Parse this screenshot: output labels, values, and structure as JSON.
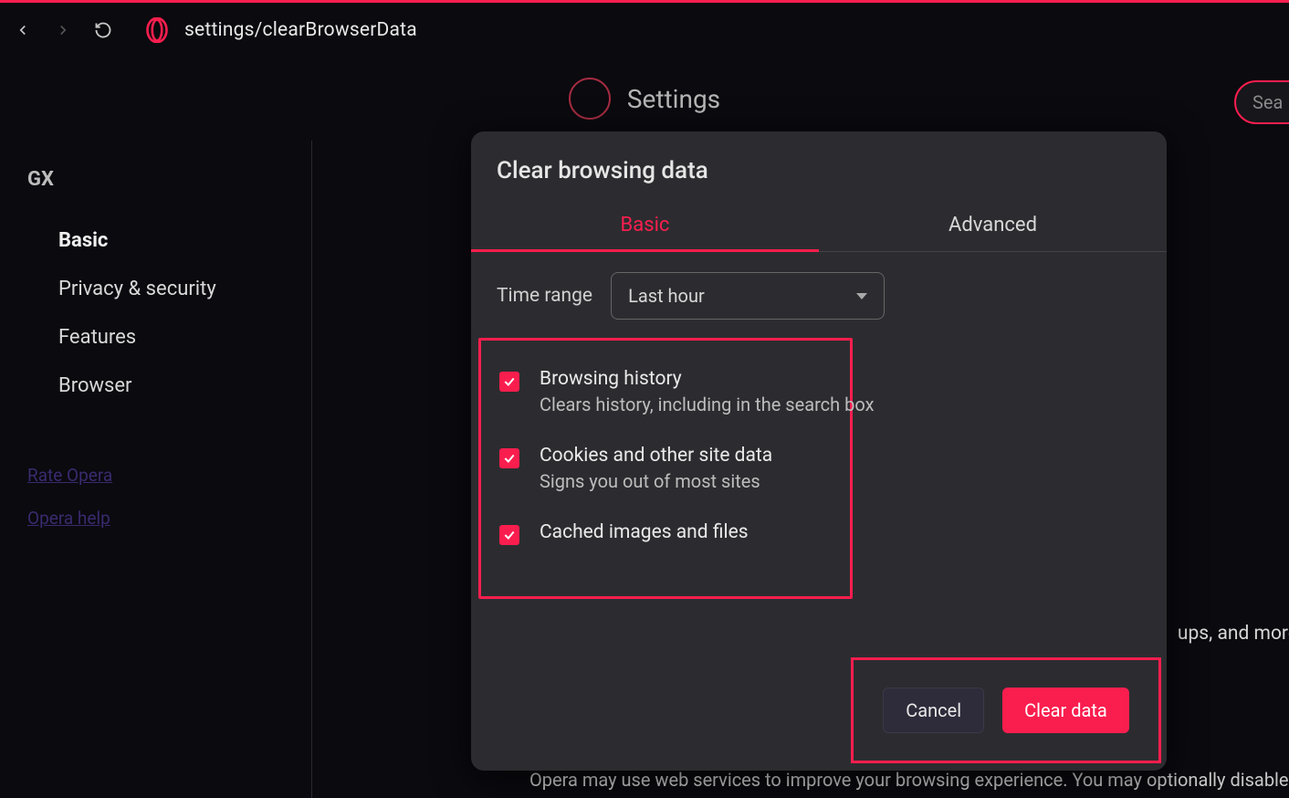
{
  "toolbar": {
    "url": "settings/clearBrowserData"
  },
  "settings": {
    "title": "Settings",
    "search_placeholder": "Sea"
  },
  "sidebar": {
    "group": "GX",
    "items": [
      {
        "label": "Basic",
        "active": true
      },
      {
        "label": "Privacy & security",
        "active": false
      },
      {
        "label": "Features",
        "active": false
      },
      {
        "label": "Browser",
        "active": false
      }
    ],
    "links": [
      {
        "label": "Rate Opera"
      },
      {
        "label": "Opera help"
      }
    ]
  },
  "background": {
    "line1": "ups, and more",
    "line2": "Opera may use web services to improve your browsing experience. You may optionally disable th"
  },
  "dialog": {
    "title": "Clear browsing data",
    "tabs": [
      {
        "label": "Basic",
        "active": true
      },
      {
        "label": "Advanced",
        "active": false
      }
    ],
    "time_range_label": "Time range",
    "time_range_value": "Last hour",
    "options": [
      {
        "title": "Browsing history",
        "desc": "Clears history, including in the search box",
        "checked": true
      },
      {
        "title": "Cookies and other site data",
        "desc": "Signs you out of most sites",
        "checked": true
      },
      {
        "title": "Cached images and files",
        "desc": "",
        "checked": true
      }
    ],
    "buttons": {
      "cancel": "Cancel",
      "confirm": "Clear data"
    }
  },
  "colors": {
    "accent": "#fa1e4e"
  }
}
